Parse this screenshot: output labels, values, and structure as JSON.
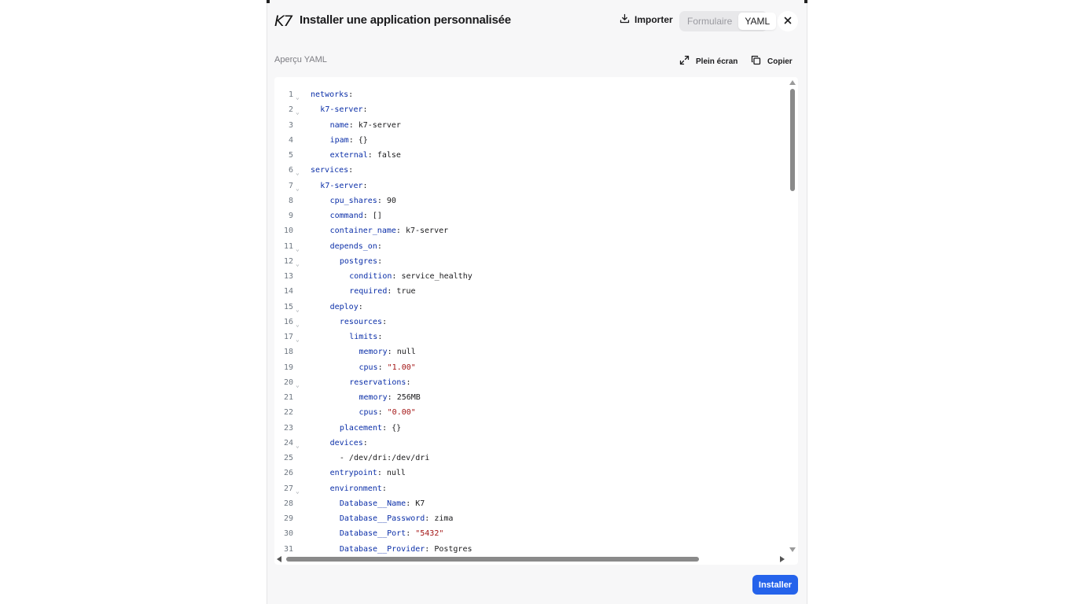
{
  "header": {
    "logo": "K7",
    "title": "Installer une application personnalisée",
    "import_label": "Importer",
    "toggle": {
      "options": [
        "Formulaire",
        "YAML"
      ],
      "selected": "YAML"
    }
  },
  "subheader": {
    "label": "Aperçu YAML",
    "fullscreen_label": "Plein écran",
    "copy_label": "Copier"
  },
  "footer": {
    "install_label": "Installer"
  },
  "colors": {
    "accent": "#2563eb",
    "key": "#0b2fa8",
    "string": "#a31515"
  },
  "code_lines": [
    {
      "n": "1",
      "fold": true,
      "indent": 0,
      "key": "networks",
      "value": "",
      "type": "plain"
    },
    {
      "n": "2",
      "fold": true,
      "indent": 1,
      "key": "k7-server",
      "value": "",
      "type": "plain"
    },
    {
      "n": "3",
      "fold": false,
      "indent": 2,
      "key": "name",
      "value": "k7-server",
      "type": "plain"
    },
    {
      "n": "4",
      "fold": false,
      "indent": 2,
      "key": "ipam",
      "value": "{}",
      "type": "plain"
    },
    {
      "n": "5",
      "fold": false,
      "indent": 2,
      "key": "external",
      "value": "false",
      "type": "plain"
    },
    {
      "n": "6",
      "fold": true,
      "indent": 0,
      "key": "services",
      "value": "",
      "type": "plain"
    },
    {
      "n": "7",
      "fold": true,
      "indent": 1,
      "key": "k7-server",
      "value": "",
      "type": "plain"
    },
    {
      "n": "8",
      "fold": false,
      "indent": 2,
      "key": "cpu_shares",
      "value": "90",
      "type": "plain"
    },
    {
      "n": "9",
      "fold": false,
      "indent": 2,
      "key": "command",
      "value": "[]",
      "type": "plain"
    },
    {
      "n": "10",
      "fold": false,
      "indent": 2,
      "key": "container_name",
      "value": "k7-server",
      "type": "plain"
    },
    {
      "n": "11",
      "fold": true,
      "indent": 2,
      "key": "depends_on",
      "value": "",
      "type": "plain"
    },
    {
      "n": "12",
      "fold": true,
      "indent": 3,
      "key": "postgres",
      "value": "",
      "type": "plain"
    },
    {
      "n": "13",
      "fold": false,
      "indent": 4,
      "key": "condition",
      "value": "service_healthy",
      "type": "plain"
    },
    {
      "n": "14",
      "fold": false,
      "indent": 4,
      "key": "required",
      "value": "true",
      "type": "plain"
    },
    {
      "n": "15",
      "fold": true,
      "indent": 2,
      "key": "deploy",
      "value": "",
      "type": "plain"
    },
    {
      "n": "16",
      "fold": true,
      "indent": 3,
      "key": "resources",
      "value": "",
      "type": "plain"
    },
    {
      "n": "17",
      "fold": true,
      "indent": 4,
      "key": "limits",
      "value": "",
      "type": "plain"
    },
    {
      "n": "18",
      "fold": false,
      "indent": 5,
      "key": "memory",
      "value": "null",
      "type": "plain"
    },
    {
      "n": "19",
      "fold": false,
      "indent": 5,
      "key": "cpus",
      "value": "\"1.00\"",
      "type": "string"
    },
    {
      "n": "20",
      "fold": true,
      "indent": 4,
      "key": "reservations",
      "value": "",
      "type": "plain"
    },
    {
      "n": "21",
      "fold": false,
      "indent": 5,
      "key": "memory",
      "value": "256MB",
      "type": "plain"
    },
    {
      "n": "22",
      "fold": false,
      "indent": 5,
      "key": "cpus",
      "value": "\"0.00\"",
      "type": "string"
    },
    {
      "n": "23",
      "fold": false,
      "indent": 3,
      "key": "placement",
      "value": "{}",
      "type": "plain"
    },
    {
      "n": "24",
      "fold": true,
      "indent": 2,
      "key": "devices",
      "value": "",
      "type": "plain"
    },
    {
      "n": "25",
      "fold": false,
      "indent": 3,
      "key": "",
      "value": "- /dev/dri:/dev/dri",
      "type": "item"
    },
    {
      "n": "26",
      "fold": false,
      "indent": 2,
      "key": "entrypoint",
      "value": "null",
      "type": "plain"
    },
    {
      "n": "27",
      "fold": true,
      "indent": 2,
      "key": "environment",
      "value": "",
      "type": "plain"
    },
    {
      "n": "28",
      "fold": false,
      "indent": 3,
      "key": "Database__Name",
      "value": "K7",
      "type": "plain"
    },
    {
      "n": "29",
      "fold": false,
      "indent": 3,
      "key": "Database__Password",
      "value": "zima",
      "type": "plain"
    },
    {
      "n": "30",
      "fold": false,
      "indent": 3,
      "key": "Database__Port",
      "value": "\"5432\"",
      "type": "string"
    },
    {
      "n": "31",
      "fold": false,
      "indent": 3,
      "key": "Database__Provider",
      "value": "Postgres",
      "type": "plain"
    }
  ]
}
